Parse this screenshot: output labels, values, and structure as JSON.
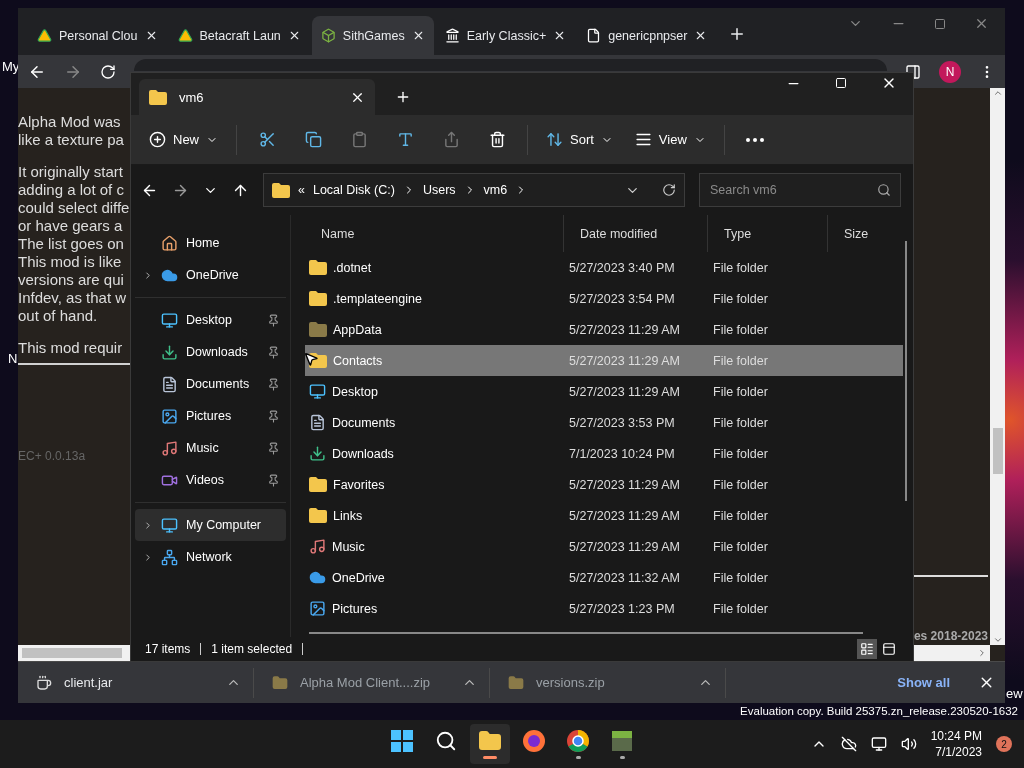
{
  "desktop": {
    "labels": [
      "My",
      "N",
      "ew"
    ],
    "watermark": "Evaluation copy. Build 25375.zn_release.230520-1632"
  },
  "browser": {
    "tabs": [
      {
        "title": "Personal Clou",
        "kind": "drive",
        "selected": false
      },
      {
        "title": "Betacraft Laun",
        "kind": "drive",
        "selected": false
      },
      {
        "title": "SithGames",
        "kind": "cube",
        "selected": true
      },
      {
        "title": "Early Classic+",
        "kind": "bank",
        "selected": false
      },
      {
        "title": "genericpnpser",
        "kind": "page",
        "selected": false
      }
    ],
    "avatar": "N",
    "page": {
      "paragraphs": [
        [
          "Alpha Mod was",
          "like a texture pa"
        ],
        [
          "It originally start",
          "adding a lot of c",
          "could select diffe",
          "or have gears a",
          "The list goes on",
          "This mod is like",
          "versions are qui",
          "Infdev, as that w",
          "out of hand."
        ],
        [
          "This mod requir"
        ]
      ],
      "version": "EC+ 0.0.13a",
      "footer": "es 2018-2023"
    },
    "downloads": [
      {
        "name": "client.jar",
        "kind": "jar"
      },
      {
        "name": "Alpha Mod Client....zip",
        "kind": "zip"
      },
      {
        "name": "versions.zip",
        "kind": "zip"
      }
    ],
    "show_all": "Show all"
  },
  "explorer": {
    "tab": {
      "title": "vm6",
      "selected": true
    },
    "toolbar": {
      "new": "New",
      "sort": "Sort",
      "view": "View"
    },
    "path_prefix": "«",
    "path": [
      "Local Disk (C:)",
      "Users",
      "vm6"
    ],
    "search": {
      "placeholder": "Search vm6"
    },
    "sidebar": [
      {
        "items": [
          {
            "label": "Home",
            "kind": "home",
            "expandable": false,
            "pinned": false,
            "selected": false
          },
          {
            "label": "OneDrive",
            "kind": "onedrive",
            "expandable": true,
            "pinned": false,
            "selected": false
          }
        ]
      },
      {
        "items": [
          {
            "label": "Desktop",
            "kind": "desktop",
            "expandable": false,
            "pinned": true,
            "selected": false
          },
          {
            "label": "Downloads",
            "kind": "downloads",
            "expandable": false,
            "pinned": true,
            "selected": false
          },
          {
            "label": "Documents",
            "kind": "documents",
            "expandable": false,
            "pinned": true,
            "selected": false
          },
          {
            "label": "Pictures",
            "kind": "pictures",
            "expandable": false,
            "pinned": true,
            "selected": false
          },
          {
            "label": "Music",
            "kind": "music",
            "expandable": false,
            "pinned": true,
            "selected": false
          },
          {
            "label": "Videos",
            "kind": "videos",
            "expandable": false,
            "pinned": true,
            "selected": false
          }
        ]
      },
      {
        "items": [
          {
            "label": "My Computer",
            "kind": "computer",
            "expandable": true,
            "pinned": false,
            "selected": true
          },
          {
            "label": "Network",
            "kind": "network",
            "expandable": true,
            "pinned": false,
            "selected": false
          }
        ]
      }
    ],
    "columns": [
      "Name",
      "Date modified",
      "Type",
      "Size"
    ],
    "rows": [
      {
        "name": ".dotnet",
        "kind": "folder",
        "date": "5/27/2023 3:40 PM",
        "type": "File folder",
        "selected": false
      },
      {
        "name": ".templateengine",
        "kind": "folder",
        "date": "5/27/2023 3:54 PM",
        "type": "File folder",
        "selected": false
      },
      {
        "name": "AppData",
        "kind": "appdata",
        "date": "5/27/2023 11:29 AM",
        "type": "File folder",
        "selected": false
      },
      {
        "name": "Contacts",
        "kind": "folder",
        "date": "5/27/2023 11:29 AM",
        "type": "File folder",
        "selected": true
      },
      {
        "name": "Desktop",
        "kind": "desktop",
        "date": "5/27/2023 11:29 AM",
        "type": "File folder",
        "selected": false
      },
      {
        "name": "Documents",
        "kind": "documents",
        "date": "5/27/2023 3:53 PM",
        "type": "File folder",
        "selected": false
      },
      {
        "name": "Downloads",
        "kind": "downloads",
        "date": "7/1/2023 10:24 PM",
        "type": "File folder",
        "selected": false
      },
      {
        "name": "Favorites",
        "kind": "folder",
        "date": "5/27/2023 11:29 AM",
        "type": "File folder",
        "selected": false
      },
      {
        "name": "Links",
        "kind": "folder",
        "date": "5/27/2023 11:29 AM",
        "type": "File folder",
        "selected": false
      },
      {
        "name": "Music",
        "kind": "music",
        "date": "5/27/2023 11:29 AM",
        "type": "File folder",
        "selected": false
      },
      {
        "name": "OneDrive",
        "kind": "onedrive",
        "date": "5/27/2023 11:32 AM",
        "type": "File folder",
        "selected": false
      },
      {
        "name": "Pictures",
        "kind": "pictures",
        "date": "5/27/2023 1:23 PM",
        "type": "File folder",
        "selected": false
      }
    ],
    "status": {
      "count": "17 items",
      "selection": "1 item selected"
    }
  },
  "taskbar": {
    "apps": [
      {
        "kind": "start",
        "running": false,
        "active": false
      },
      {
        "kind": "search",
        "running": false,
        "active": false
      },
      {
        "kind": "explorer",
        "running": true,
        "active": true
      },
      {
        "kind": "firefox",
        "running": false,
        "active": false
      },
      {
        "kind": "chrome",
        "running": true,
        "active": false
      },
      {
        "kind": "game",
        "running": true,
        "active": false
      }
    ],
    "time": "10:24 PM",
    "date": "7/1/2023",
    "notifications": "2"
  }
}
